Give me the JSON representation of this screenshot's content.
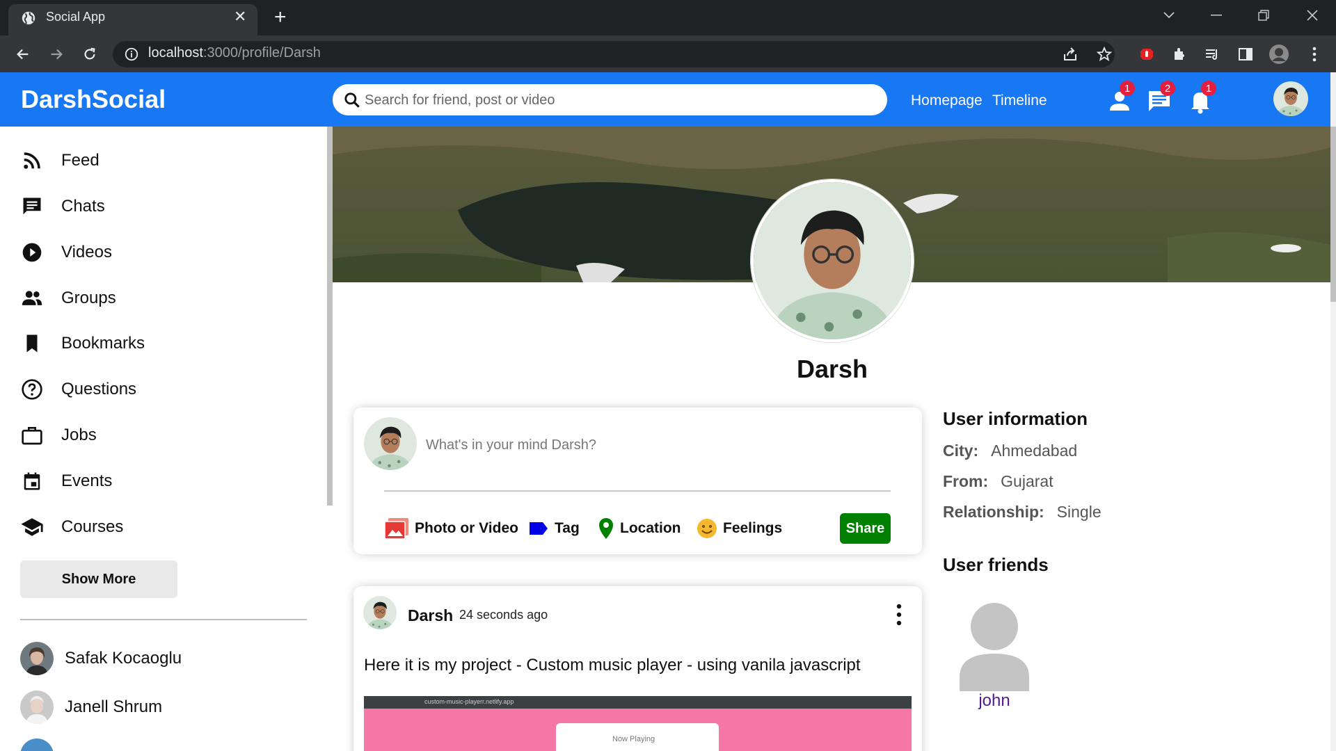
{
  "browser": {
    "tab_title": "Social App",
    "url_host": "localhost",
    "url_path": ":3000/profile/Darsh"
  },
  "app": {
    "logo": "DarshSocial",
    "search": {
      "placeholder": "Search for friend, post or video"
    },
    "links": [
      "Homepage",
      "Timeline"
    ],
    "badges": {
      "friend_requests": "1",
      "messages": "2",
      "notifications": "1"
    },
    "colors": {
      "primary": "#1877f2",
      "share": "#008000",
      "badge": "#e41e3f"
    }
  },
  "sidebar": {
    "items": [
      {
        "label": "Feed",
        "icon": "rss-feed-icon"
      },
      {
        "label": "Chats",
        "icon": "chat-icon"
      },
      {
        "label": "Videos",
        "icon": "play-circle-icon"
      },
      {
        "label": "Groups",
        "icon": "group-icon"
      },
      {
        "label": "Bookmarks",
        "icon": "bookmark-icon"
      },
      {
        "label": "Questions",
        "icon": "help-outline-icon"
      },
      {
        "label": "Jobs",
        "icon": "work-outline-icon"
      },
      {
        "label": "Events",
        "icon": "event-icon"
      },
      {
        "label": "Courses",
        "icon": "school-icon"
      }
    ],
    "show_more": "Show More",
    "friends": [
      "Safak Kocaoglu",
      "Janell Shrum"
    ]
  },
  "profile": {
    "name": "Darsh"
  },
  "share": {
    "placeholder": "What's in your mind Darsh?",
    "options": [
      "Photo or Video",
      "Tag",
      "Location",
      "Feelings"
    ],
    "button": "Share"
  },
  "post": {
    "author": "Darsh",
    "time": "24 seconds ago",
    "text": "Here it is my project - Custom music player - using vanila javascript",
    "image_url": "custom-music-playerr.netlify.app",
    "image_caption": "Now Playing"
  },
  "user_info": {
    "title": "User information",
    "rows": [
      {
        "key": "City:",
        "value": "Ahmedabad"
      },
      {
        "key": "From:",
        "value": "Gujarat"
      },
      {
        "key": "Relationship:",
        "value": "Single"
      }
    ]
  },
  "user_friends": {
    "title": "User friends",
    "friends": [
      "john"
    ]
  }
}
